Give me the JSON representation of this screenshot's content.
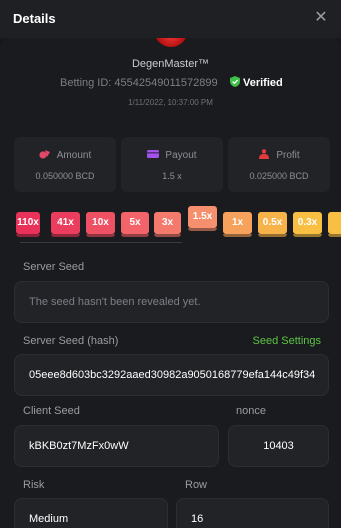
{
  "header": {
    "title": "Details",
    "close_icon": "close-icon"
  },
  "user": {
    "name": "DegenMaster™",
    "betting_id": "Betting ID: 45542549011572899",
    "verified_label": "Verified",
    "datetime": "1/11/2022, 10:37:00 PM"
  },
  "stats": [
    {
      "label": "Amount",
      "value": "0.050000 BCD",
      "icon": "coins-icon",
      "color": "#e0486a"
    },
    {
      "label": "Payout",
      "value": "1.5 x",
      "icon": "card-icon",
      "color": "#a253e8"
    },
    {
      "label": "Profit",
      "value": "0.025000 BCD",
      "icon": "money-bag-icon",
      "color": "#e23b3b"
    }
  ],
  "multipliers": [
    {
      "label": "110x",
      "color": "#e8325a"
    },
    {
      "label": "41x",
      "color": "#eb3e5f"
    },
    {
      "label": "10x",
      "color": "#ee5064"
    },
    {
      "label": "5x",
      "color": "#f2636a"
    },
    {
      "label": "3x",
      "color": "#f47a6e"
    },
    {
      "label": "1.5x",
      "color": "#f68f6d",
      "selected": true
    },
    {
      "label": "1x",
      "color": "#f7a25c"
    },
    {
      "label": "0.5x",
      "color": "#f8b24a"
    },
    {
      "label": "0.3x",
      "color": "#f9bf42"
    },
    {
      "label": "",
      "color": "#f9bf42"
    }
  ],
  "server_seed": {
    "label": "Server Seed",
    "value": "The seed hasn't been revealed yet."
  },
  "server_seed_hash": {
    "label": "Server Seed (hash)",
    "link": "Seed Settings",
    "value": "05eee8d603bc3292aaed30982a9050168779efa144c49f34"
  },
  "client_seed": {
    "label": "Client Seed",
    "value": "kBKB0zt7MzFx0wW"
  },
  "nonce": {
    "label": "nonce",
    "value": "10403"
  },
  "risk": {
    "label": "Risk",
    "value": "Medium"
  },
  "row": {
    "label": "Row",
    "value": "16"
  }
}
